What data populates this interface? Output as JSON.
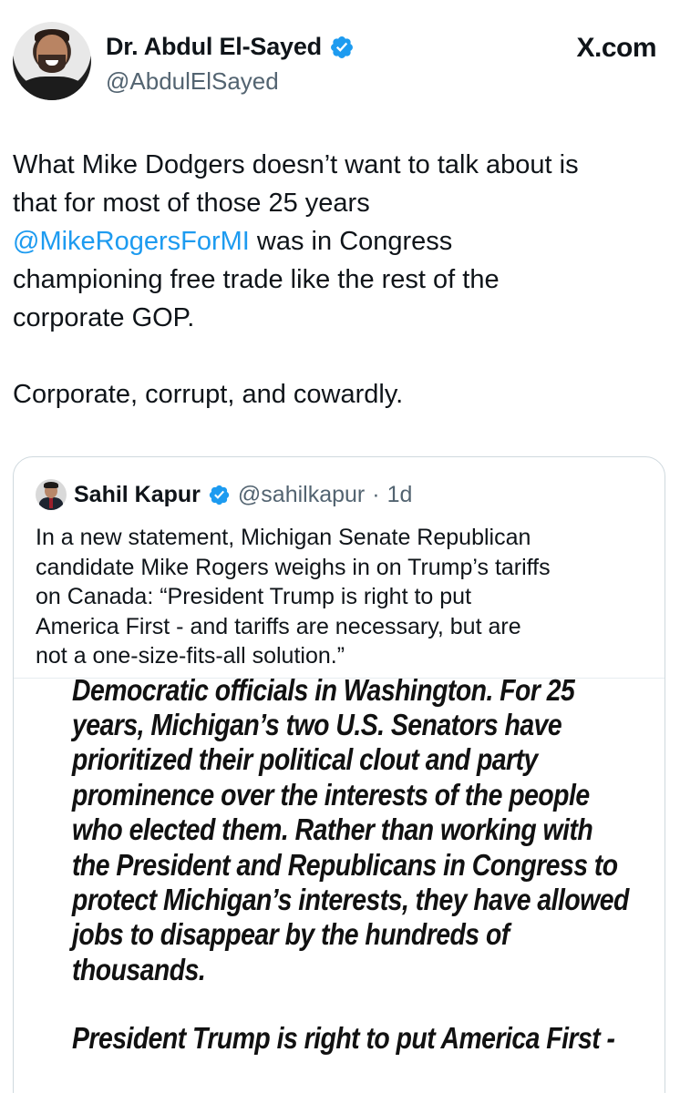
{
  "post": {
    "author": {
      "name": "Dr. Abdul El-Sayed",
      "handle": "@AbdulElSayed",
      "verified": true,
      "avatar_icon": "profile-photo"
    },
    "site_label": "X.com",
    "text_lines": {
      "line1": "What Mike Dodgers doesn’t want to talk about is",
      "line2": "that for most of those 25 years",
      "mention": "@MikeRogersForMI",
      "line3_rest": " was in Congress",
      "line4": "championing free trade like the rest of the",
      "line5": "corporate GOP.",
      "line6": "Corporate, corrupt, and cowardly."
    }
  },
  "quote": {
    "author": {
      "name": "Sahil Kapur",
      "handle": "@sahilkapur",
      "separator": "·",
      "time": "1d",
      "verified": true
    },
    "text_lines": [
      "In a new statement, Michigan Senate Republican",
      "candidate Mike Rogers weighs in on Trump’s tariffs",
      "on Canada: “President Trump is right to put",
      "America First - and tariffs are necessary, but are",
      "not a one-size-fits-all solution.”"
    ],
    "image_text_lines": [
      "Democratic officials in Washington. For 25",
      "years, Michigan’s two U.S. Senators have",
      "prioritized their political clout and party",
      "prominence over the interests of the people",
      "who elected them. Rather than working with",
      "the President and Republicans in Congress to",
      "protect Michigan’s interests, they have allowed",
      "jobs to disappear by the hundreds of",
      "thousands.",
      "President Trump is right to put America First -"
    ]
  },
  "colors": {
    "link": "#1d9bf0",
    "verified_badge": "#1d9bf0",
    "secondary_text": "#536471",
    "border": "#cfd9de"
  }
}
